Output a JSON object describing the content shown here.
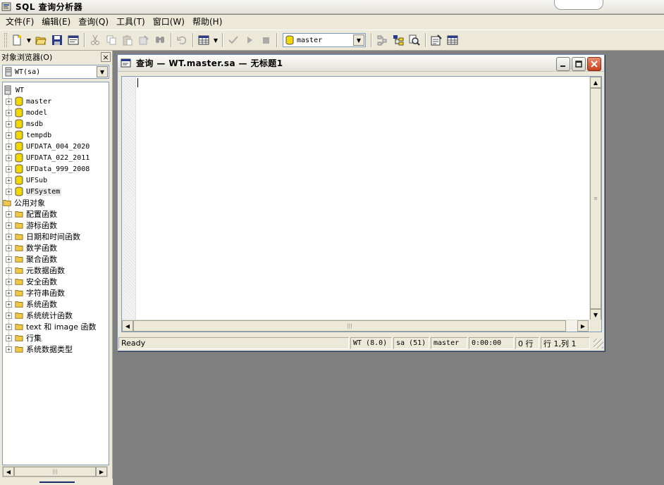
{
  "app": {
    "title": "SQL 查询分析器"
  },
  "menubar": {
    "items": [
      "文件(F)",
      "编辑(E)",
      "查询(Q)",
      "工具(T)",
      "窗口(W)",
      "帮助(H)"
    ]
  },
  "toolbar": {
    "database": "master",
    "buttons": [
      "new-query-icon",
      "open-folder-icon",
      "save-icon",
      "load-script-icon",
      "cut-icon",
      "copy-icon",
      "paste-icon",
      "clear-icon",
      "find-icon",
      "undo-icon",
      "results-grid-icon",
      "parse-icon",
      "execute-icon",
      "stop-icon",
      "plan-icon",
      "object-browser-icon",
      "object-search-icon",
      "properties-icon",
      "grid-icon"
    ]
  },
  "object_browser": {
    "title": "对象浏览器(O)",
    "close_label": "×",
    "server": "WT(sa)",
    "tree": {
      "root": "WT",
      "databases": [
        "master",
        "model",
        "msdb",
        "tempdb",
        "UFDATA_004_2020",
        "UFDATA_022_2011",
        "UFData_999_2008",
        "UFSub",
        "UFSystem"
      ],
      "common_objects": "公用对象",
      "folders": [
        "配置函数",
        "游标函数",
        "日期和时间函数",
        "数学函数",
        "聚合函数",
        "元数据函数",
        "安全函数",
        "字符串函数",
        "系统函数",
        "系统统计函数",
        "text 和 image 函数",
        "行集",
        "系统数据类型"
      ]
    }
  },
  "query_window": {
    "title": "查询 — WT.master.sa — 无标题1",
    "status": {
      "state": "Ready",
      "server": "WT (8.0)",
      "user": "sa (51)",
      "database": "master",
      "time": "0:00:00",
      "rows": "0 行",
      "position": "行 1,列 1"
    }
  },
  "colors": {
    "workspace": "#808080",
    "chrome": "#ece9d8",
    "db_yellow": "#f2d800",
    "close_red": "#c8401e"
  }
}
